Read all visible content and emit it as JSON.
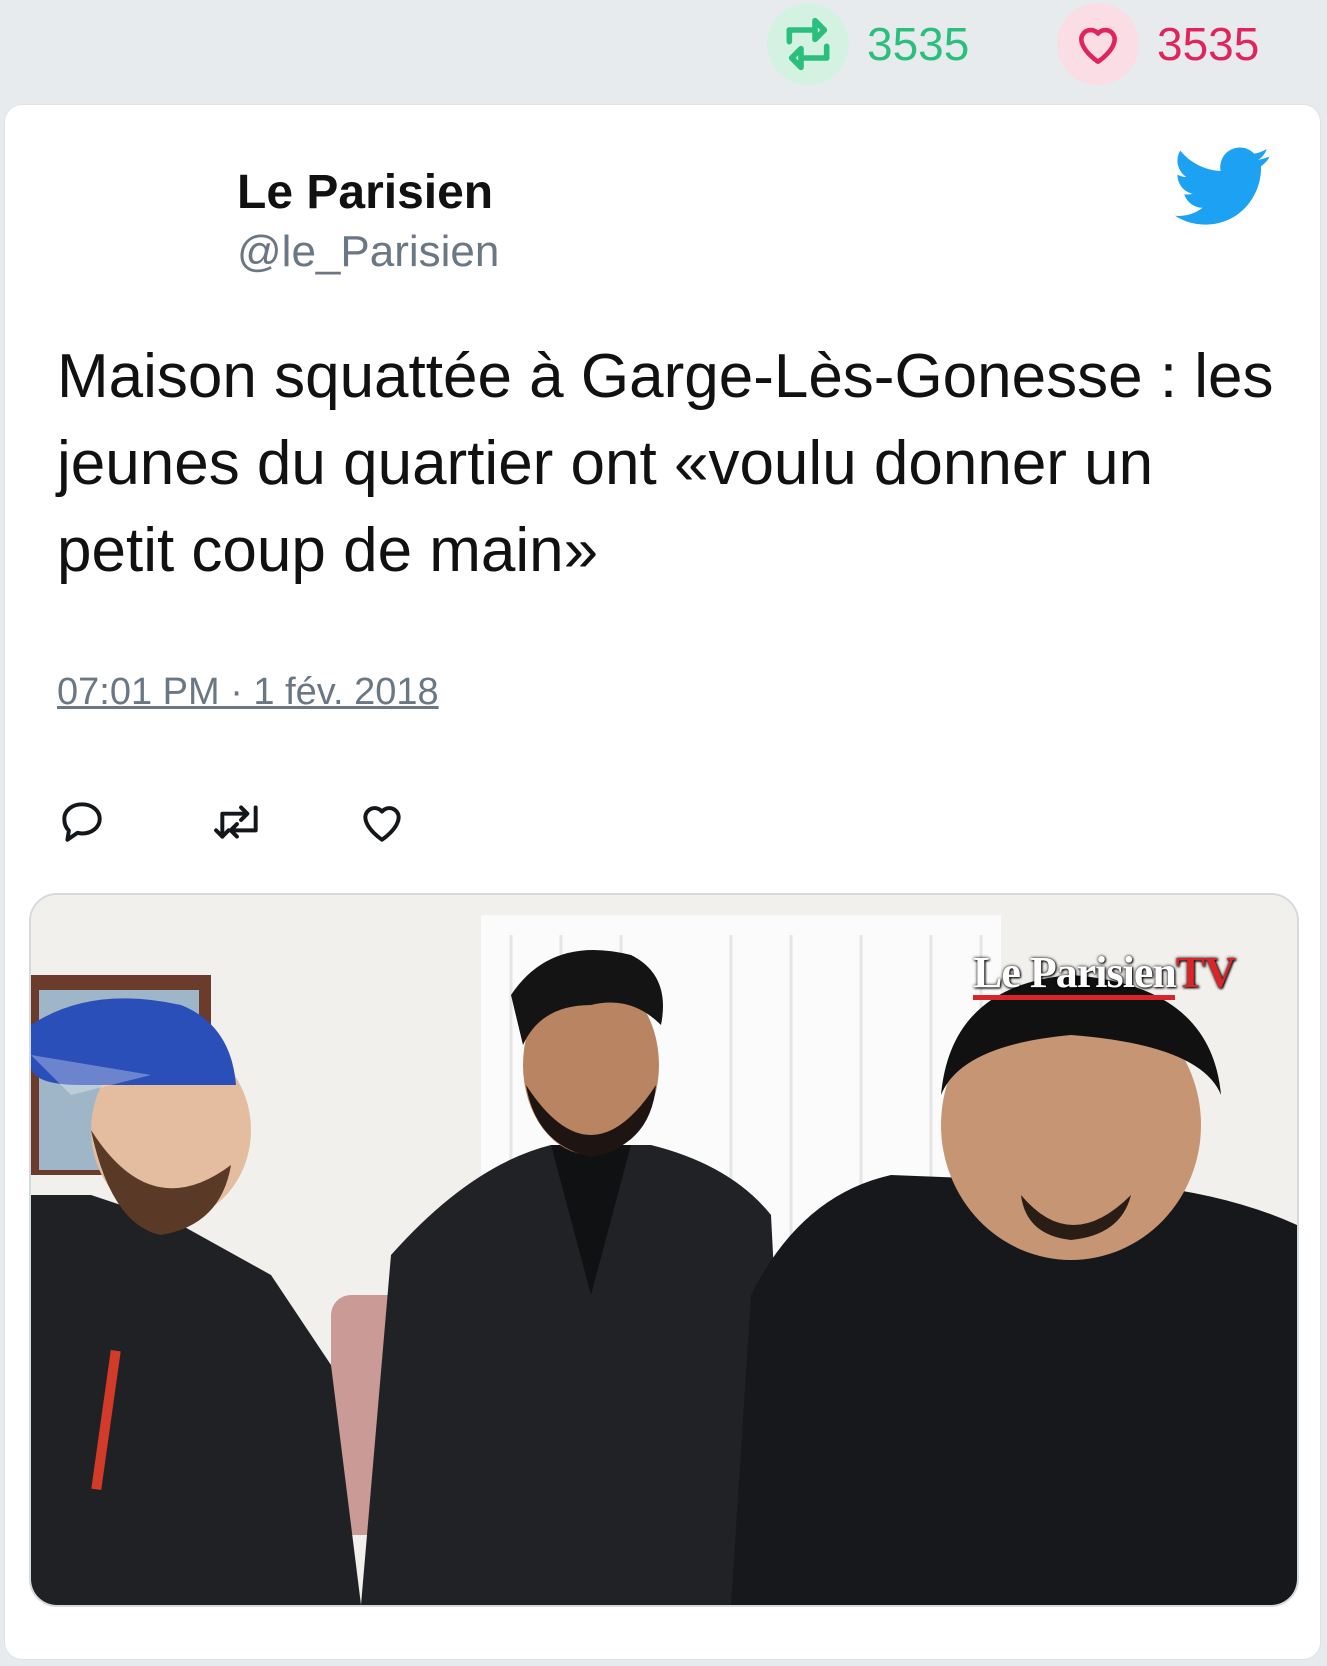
{
  "stats": {
    "retweets": "3535",
    "likes": "3535",
    "retweet_color": "#2bbf7e",
    "like_color": "#e0245e"
  },
  "tweet": {
    "author_name": "Le Parisien",
    "author_handle": "@le_Parisien",
    "text": "Maison squattée à Garge-Lès-Gonesse : les jeunes du quartier ont «voulu donner un petit coup de main»",
    "timestamp": "07:01 PM · 1 fév. 2018",
    "brand_icon": "twitter-bird-icon",
    "actions": [
      "reply-icon",
      "retweet-icon",
      "like-icon"
    ]
  },
  "media": {
    "logo_main": "Le Parisien",
    "logo_suffix": "TV",
    "description_icon": "photo"
  }
}
